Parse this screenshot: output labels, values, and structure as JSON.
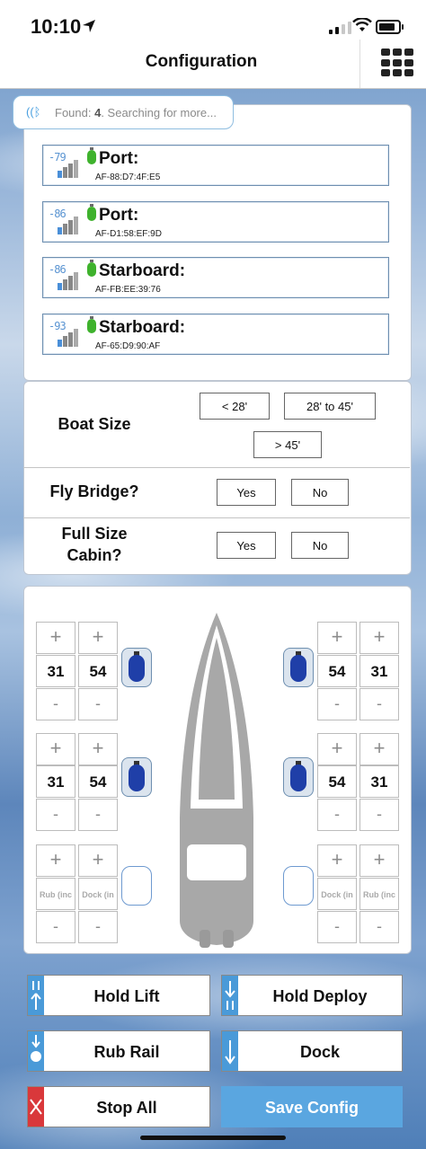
{
  "status": {
    "time": "10:10"
  },
  "nav": {
    "title": "Configuration",
    "menu_icon": "grid-icon"
  },
  "scan": {
    "prefix": "Found: ",
    "count": "4",
    "suffix": ". Searching for more..."
  },
  "devices": [
    {
      "rssi": "-79",
      "name": "Port:",
      "mac": "AF-88:D7:4F:E5"
    },
    {
      "rssi": "-86",
      "name": "Port:",
      "mac": "AF-D1:58:EF:9D"
    },
    {
      "rssi": "-86",
      "name": "Starboard:",
      "mac": "AF-FB:EE:39:76"
    },
    {
      "rssi": "-93",
      "name": "Starboard:",
      "mac": "AF-65:D9:90:AF"
    }
  ],
  "boat": {
    "size_label": "Boat Size",
    "size_options": [
      "< 28'",
      "28' to 45'",
      "> 45'"
    ],
    "fly_bridge_label": "Fly Bridge?",
    "cabin_label_1": "Full Size",
    "cabin_label_2": "Cabin?",
    "yes": "Yes",
    "no": "No"
  },
  "fenders": {
    "plus": "+",
    "minus": "-",
    "port_rows": [
      {
        "a": "31",
        "b": "54"
      },
      {
        "a": "31",
        "b": "54"
      },
      {
        "a": "Rub (inc",
        "b": "Dock (in"
      }
    ],
    "starboard_rows": [
      {
        "a": "54",
        "b": "31"
      },
      {
        "a": "54",
        "b": "31"
      },
      {
        "a": "Dock (in",
        "b": "Rub (inc"
      }
    ]
  },
  "actions": {
    "hold_lift": "Hold Lift",
    "hold_deploy": "Hold Deploy",
    "rub_rail": "Rub Rail",
    "dock": "Dock",
    "stop_all": "Stop All",
    "save_config": "Save Config"
  },
  "colors": {
    "accent": "#4a9ad8",
    "danger": "#d9383b",
    "fender_blue": "#1f3fa8"
  }
}
